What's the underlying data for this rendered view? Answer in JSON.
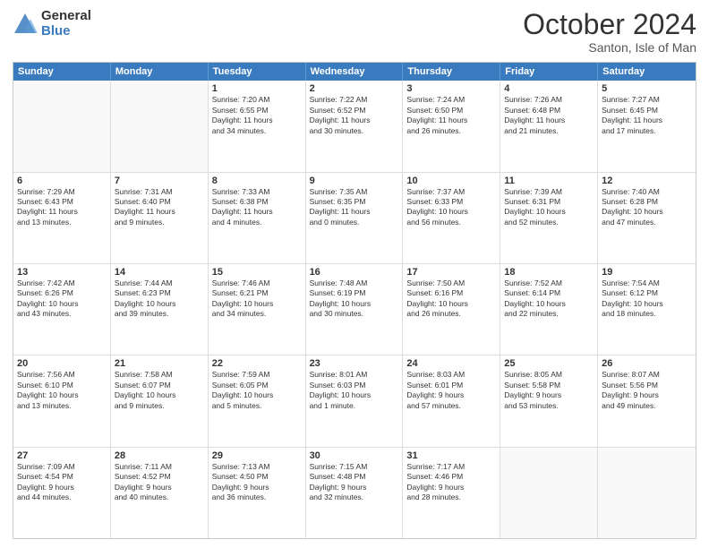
{
  "logo": {
    "general": "General",
    "blue": "Blue"
  },
  "title": "October 2024",
  "subtitle": "Santon, Isle of Man",
  "header_days": [
    "Sunday",
    "Monday",
    "Tuesday",
    "Wednesday",
    "Thursday",
    "Friday",
    "Saturday"
  ],
  "weeks": [
    [
      {
        "day": "",
        "info": ""
      },
      {
        "day": "",
        "info": ""
      },
      {
        "day": "1",
        "info": "Sunrise: 7:20 AM\nSunset: 6:55 PM\nDaylight: 11 hours\nand 34 minutes."
      },
      {
        "day": "2",
        "info": "Sunrise: 7:22 AM\nSunset: 6:52 PM\nDaylight: 11 hours\nand 30 minutes."
      },
      {
        "day": "3",
        "info": "Sunrise: 7:24 AM\nSunset: 6:50 PM\nDaylight: 11 hours\nand 26 minutes."
      },
      {
        "day": "4",
        "info": "Sunrise: 7:26 AM\nSunset: 6:48 PM\nDaylight: 11 hours\nand 21 minutes."
      },
      {
        "day": "5",
        "info": "Sunrise: 7:27 AM\nSunset: 6:45 PM\nDaylight: 11 hours\nand 17 minutes."
      }
    ],
    [
      {
        "day": "6",
        "info": "Sunrise: 7:29 AM\nSunset: 6:43 PM\nDaylight: 11 hours\nand 13 minutes."
      },
      {
        "day": "7",
        "info": "Sunrise: 7:31 AM\nSunset: 6:40 PM\nDaylight: 11 hours\nand 9 minutes."
      },
      {
        "day": "8",
        "info": "Sunrise: 7:33 AM\nSunset: 6:38 PM\nDaylight: 11 hours\nand 4 minutes."
      },
      {
        "day": "9",
        "info": "Sunrise: 7:35 AM\nSunset: 6:35 PM\nDaylight: 11 hours\nand 0 minutes."
      },
      {
        "day": "10",
        "info": "Sunrise: 7:37 AM\nSunset: 6:33 PM\nDaylight: 10 hours\nand 56 minutes."
      },
      {
        "day": "11",
        "info": "Sunrise: 7:39 AM\nSunset: 6:31 PM\nDaylight: 10 hours\nand 52 minutes."
      },
      {
        "day": "12",
        "info": "Sunrise: 7:40 AM\nSunset: 6:28 PM\nDaylight: 10 hours\nand 47 minutes."
      }
    ],
    [
      {
        "day": "13",
        "info": "Sunrise: 7:42 AM\nSunset: 6:26 PM\nDaylight: 10 hours\nand 43 minutes."
      },
      {
        "day": "14",
        "info": "Sunrise: 7:44 AM\nSunset: 6:23 PM\nDaylight: 10 hours\nand 39 minutes."
      },
      {
        "day": "15",
        "info": "Sunrise: 7:46 AM\nSunset: 6:21 PM\nDaylight: 10 hours\nand 34 minutes."
      },
      {
        "day": "16",
        "info": "Sunrise: 7:48 AM\nSunset: 6:19 PM\nDaylight: 10 hours\nand 30 minutes."
      },
      {
        "day": "17",
        "info": "Sunrise: 7:50 AM\nSunset: 6:16 PM\nDaylight: 10 hours\nand 26 minutes."
      },
      {
        "day": "18",
        "info": "Sunrise: 7:52 AM\nSunset: 6:14 PM\nDaylight: 10 hours\nand 22 minutes."
      },
      {
        "day": "19",
        "info": "Sunrise: 7:54 AM\nSunset: 6:12 PM\nDaylight: 10 hours\nand 18 minutes."
      }
    ],
    [
      {
        "day": "20",
        "info": "Sunrise: 7:56 AM\nSunset: 6:10 PM\nDaylight: 10 hours\nand 13 minutes."
      },
      {
        "day": "21",
        "info": "Sunrise: 7:58 AM\nSunset: 6:07 PM\nDaylight: 10 hours\nand 9 minutes."
      },
      {
        "day": "22",
        "info": "Sunrise: 7:59 AM\nSunset: 6:05 PM\nDaylight: 10 hours\nand 5 minutes."
      },
      {
        "day": "23",
        "info": "Sunrise: 8:01 AM\nSunset: 6:03 PM\nDaylight: 10 hours\nand 1 minute."
      },
      {
        "day": "24",
        "info": "Sunrise: 8:03 AM\nSunset: 6:01 PM\nDaylight: 9 hours\nand 57 minutes."
      },
      {
        "day": "25",
        "info": "Sunrise: 8:05 AM\nSunset: 5:58 PM\nDaylight: 9 hours\nand 53 minutes."
      },
      {
        "day": "26",
        "info": "Sunrise: 8:07 AM\nSunset: 5:56 PM\nDaylight: 9 hours\nand 49 minutes."
      }
    ],
    [
      {
        "day": "27",
        "info": "Sunrise: 7:09 AM\nSunset: 4:54 PM\nDaylight: 9 hours\nand 44 minutes."
      },
      {
        "day": "28",
        "info": "Sunrise: 7:11 AM\nSunset: 4:52 PM\nDaylight: 9 hours\nand 40 minutes."
      },
      {
        "day": "29",
        "info": "Sunrise: 7:13 AM\nSunset: 4:50 PM\nDaylight: 9 hours\nand 36 minutes."
      },
      {
        "day": "30",
        "info": "Sunrise: 7:15 AM\nSunset: 4:48 PM\nDaylight: 9 hours\nand 32 minutes."
      },
      {
        "day": "31",
        "info": "Sunrise: 7:17 AM\nSunset: 4:46 PM\nDaylight: 9 hours\nand 28 minutes."
      },
      {
        "day": "",
        "info": ""
      },
      {
        "day": "",
        "info": ""
      }
    ]
  ]
}
